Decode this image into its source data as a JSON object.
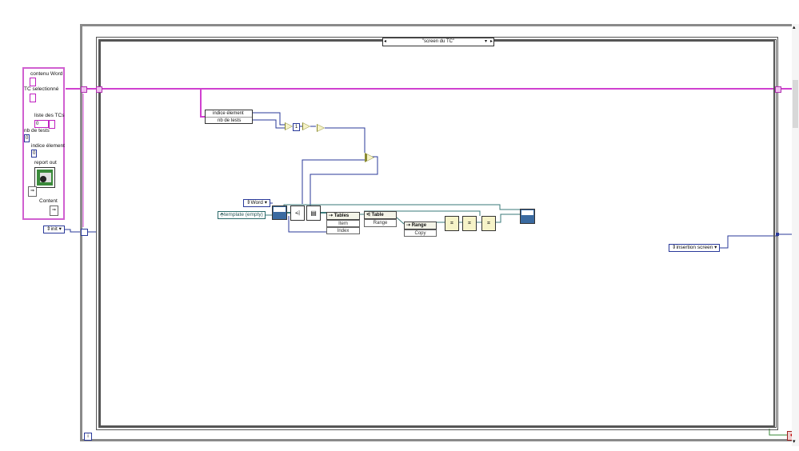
{
  "cluster": {
    "contenu_word": "contenu Word",
    "tc_selectionne": "TC selectionné",
    "liste_des_tcs": "liste des TCs",
    "liste_index": "0",
    "nb_de_tests": "nb de tests",
    "nb_de_tests_value": "0",
    "indice_element": "indice élement",
    "indice_element_value": "0",
    "report_out": "report out",
    "content": "Content"
  },
  "init_enum": "init",
  "case_selector": "\"screen du TC\"",
  "unbundle": {
    "item1": "indice élement",
    "item2": "nb de tests"
  },
  "const_1": "1",
  "word_enum": "Word",
  "template_ref": "template (empty)",
  "tables_node": {
    "header": "Tables",
    "item": "Item",
    "index": "Index"
  },
  "table_node": {
    "header": "Table",
    "range": "Range"
  },
  "range_node": {
    "header": "Range",
    "copy": "Copy"
  },
  "insertion_enum": "insertion screen",
  "iteration_label": "i",
  "colors": {
    "cluster_wire": "#d040d0",
    "numeric_wire": "#2a3a9a",
    "ref_wire": "#3a7a7a",
    "frame": "#8a8a8a"
  }
}
